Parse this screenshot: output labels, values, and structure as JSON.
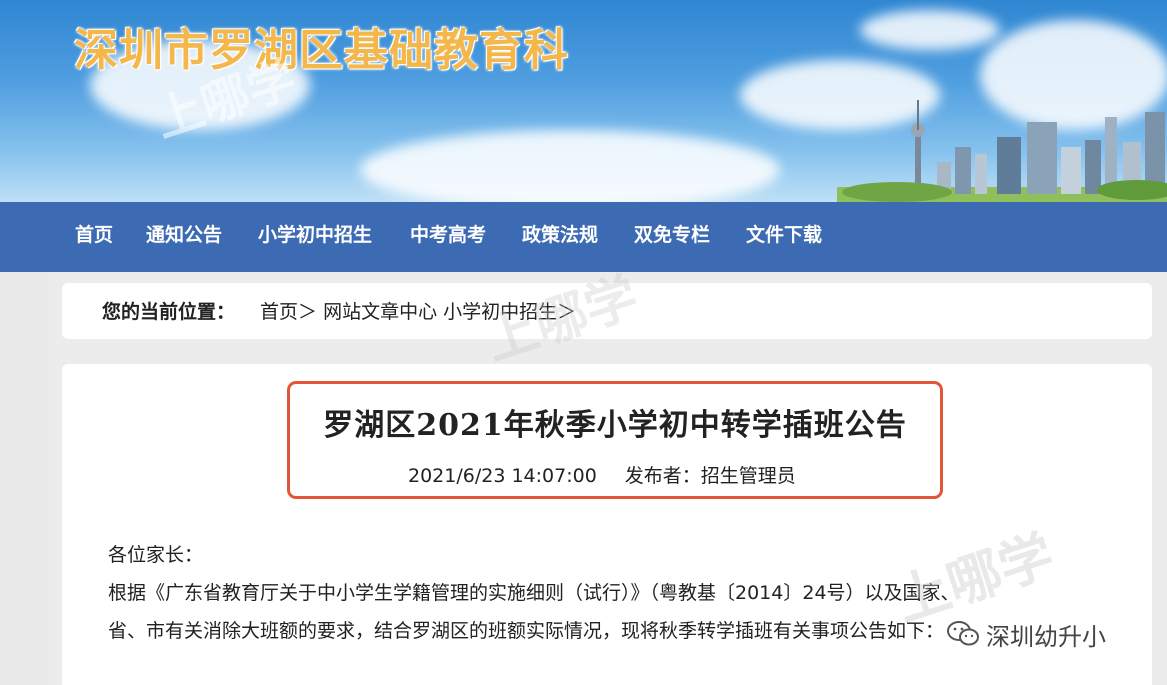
{
  "site": {
    "title": "深圳市罗湖区基础教育科",
    "colors": {
      "banner_sky": "#4f9ee0",
      "title": "#f3b74b",
      "nav_bg": "#3d6bb3",
      "highlight_border": "#e2553b"
    }
  },
  "nav": {
    "items": [
      "首页",
      "通知公告",
      "小学初中招生",
      "中考高考",
      "政策法规",
      "双免专栏",
      "文件下载"
    ]
  },
  "breadcrumb": {
    "label": "您的当前位置：",
    "home": "首页＞",
    "section": "网站文章中心",
    "category": "小学初中招生＞"
  },
  "article": {
    "title": "罗湖区2021年秋季小学初中转学插班公告",
    "date": "2021/6/23 14:07:00",
    "publisher": "发布者：招生管理员",
    "greeting": "各位家长：",
    "lines": [
      "根据《广东省教育厅关于中小学生学籍管理的实施细则（试行）》（粤教基〔2014〕24号）以及国家、",
      "省、市有关消除大班额的要求，结合罗湖区的班额实际情况，现将秋季转学插班有关事项公告如下："
    ]
  },
  "watermark": {
    "brand": "上哪学",
    "wechat_label": "深圳幼升小",
    "icon": "wechat-icon"
  }
}
